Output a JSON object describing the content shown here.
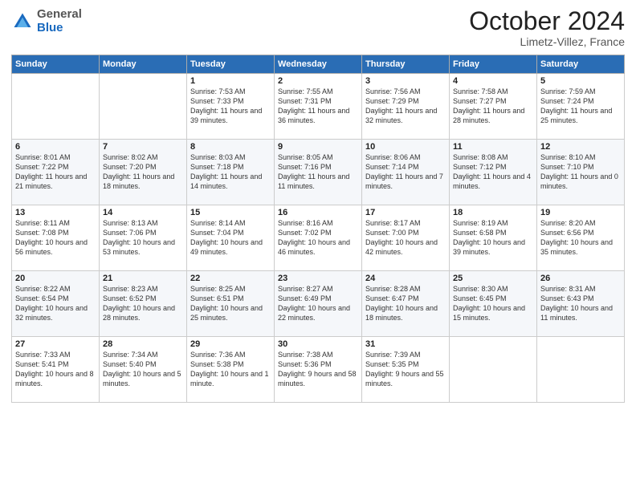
{
  "logo": {
    "general": "General",
    "blue": "Blue"
  },
  "title": "October 2024",
  "location": "Limetz-Villez, France",
  "days_of_week": [
    "Sunday",
    "Monday",
    "Tuesday",
    "Wednesday",
    "Thursday",
    "Friday",
    "Saturday"
  ],
  "weeks": [
    [
      {
        "day": "",
        "info": ""
      },
      {
        "day": "",
        "info": ""
      },
      {
        "day": "1",
        "info": "Sunrise: 7:53 AM\nSunset: 7:33 PM\nDaylight: 11 hours and 39 minutes."
      },
      {
        "day": "2",
        "info": "Sunrise: 7:55 AM\nSunset: 7:31 PM\nDaylight: 11 hours and 36 minutes."
      },
      {
        "day": "3",
        "info": "Sunrise: 7:56 AM\nSunset: 7:29 PM\nDaylight: 11 hours and 32 minutes."
      },
      {
        "day": "4",
        "info": "Sunrise: 7:58 AM\nSunset: 7:27 PM\nDaylight: 11 hours and 28 minutes."
      },
      {
        "day": "5",
        "info": "Sunrise: 7:59 AM\nSunset: 7:24 PM\nDaylight: 11 hours and 25 minutes."
      }
    ],
    [
      {
        "day": "6",
        "info": "Sunrise: 8:01 AM\nSunset: 7:22 PM\nDaylight: 11 hours and 21 minutes."
      },
      {
        "day": "7",
        "info": "Sunrise: 8:02 AM\nSunset: 7:20 PM\nDaylight: 11 hours and 18 minutes."
      },
      {
        "day": "8",
        "info": "Sunrise: 8:03 AM\nSunset: 7:18 PM\nDaylight: 11 hours and 14 minutes."
      },
      {
        "day": "9",
        "info": "Sunrise: 8:05 AM\nSunset: 7:16 PM\nDaylight: 11 hours and 11 minutes."
      },
      {
        "day": "10",
        "info": "Sunrise: 8:06 AM\nSunset: 7:14 PM\nDaylight: 11 hours and 7 minutes."
      },
      {
        "day": "11",
        "info": "Sunrise: 8:08 AM\nSunset: 7:12 PM\nDaylight: 11 hours and 4 minutes."
      },
      {
        "day": "12",
        "info": "Sunrise: 8:10 AM\nSunset: 7:10 PM\nDaylight: 11 hours and 0 minutes."
      }
    ],
    [
      {
        "day": "13",
        "info": "Sunrise: 8:11 AM\nSunset: 7:08 PM\nDaylight: 10 hours and 56 minutes."
      },
      {
        "day": "14",
        "info": "Sunrise: 8:13 AM\nSunset: 7:06 PM\nDaylight: 10 hours and 53 minutes."
      },
      {
        "day": "15",
        "info": "Sunrise: 8:14 AM\nSunset: 7:04 PM\nDaylight: 10 hours and 49 minutes."
      },
      {
        "day": "16",
        "info": "Sunrise: 8:16 AM\nSunset: 7:02 PM\nDaylight: 10 hours and 46 minutes."
      },
      {
        "day": "17",
        "info": "Sunrise: 8:17 AM\nSunset: 7:00 PM\nDaylight: 10 hours and 42 minutes."
      },
      {
        "day": "18",
        "info": "Sunrise: 8:19 AM\nSunset: 6:58 PM\nDaylight: 10 hours and 39 minutes."
      },
      {
        "day": "19",
        "info": "Sunrise: 8:20 AM\nSunset: 6:56 PM\nDaylight: 10 hours and 35 minutes."
      }
    ],
    [
      {
        "day": "20",
        "info": "Sunrise: 8:22 AM\nSunset: 6:54 PM\nDaylight: 10 hours and 32 minutes."
      },
      {
        "day": "21",
        "info": "Sunrise: 8:23 AM\nSunset: 6:52 PM\nDaylight: 10 hours and 28 minutes."
      },
      {
        "day": "22",
        "info": "Sunrise: 8:25 AM\nSunset: 6:51 PM\nDaylight: 10 hours and 25 minutes."
      },
      {
        "day": "23",
        "info": "Sunrise: 8:27 AM\nSunset: 6:49 PM\nDaylight: 10 hours and 22 minutes."
      },
      {
        "day": "24",
        "info": "Sunrise: 8:28 AM\nSunset: 6:47 PM\nDaylight: 10 hours and 18 minutes."
      },
      {
        "day": "25",
        "info": "Sunrise: 8:30 AM\nSunset: 6:45 PM\nDaylight: 10 hours and 15 minutes."
      },
      {
        "day": "26",
        "info": "Sunrise: 8:31 AM\nSunset: 6:43 PM\nDaylight: 10 hours and 11 minutes."
      }
    ],
    [
      {
        "day": "27",
        "info": "Sunrise: 7:33 AM\nSunset: 5:41 PM\nDaylight: 10 hours and 8 minutes."
      },
      {
        "day": "28",
        "info": "Sunrise: 7:34 AM\nSunset: 5:40 PM\nDaylight: 10 hours and 5 minutes."
      },
      {
        "day": "29",
        "info": "Sunrise: 7:36 AM\nSunset: 5:38 PM\nDaylight: 10 hours and 1 minute."
      },
      {
        "day": "30",
        "info": "Sunrise: 7:38 AM\nSunset: 5:36 PM\nDaylight: 9 hours and 58 minutes."
      },
      {
        "day": "31",
        "info": "Sunrise: 7:39 AM\nSunset: 5:35 PM\nDaylight: 9 hours and 55 minutes."
      },
      {
        "day": "",
        "info": ""
      },
      {
        "day": "",
        "info": ""
      }
    ]
  ]
}
